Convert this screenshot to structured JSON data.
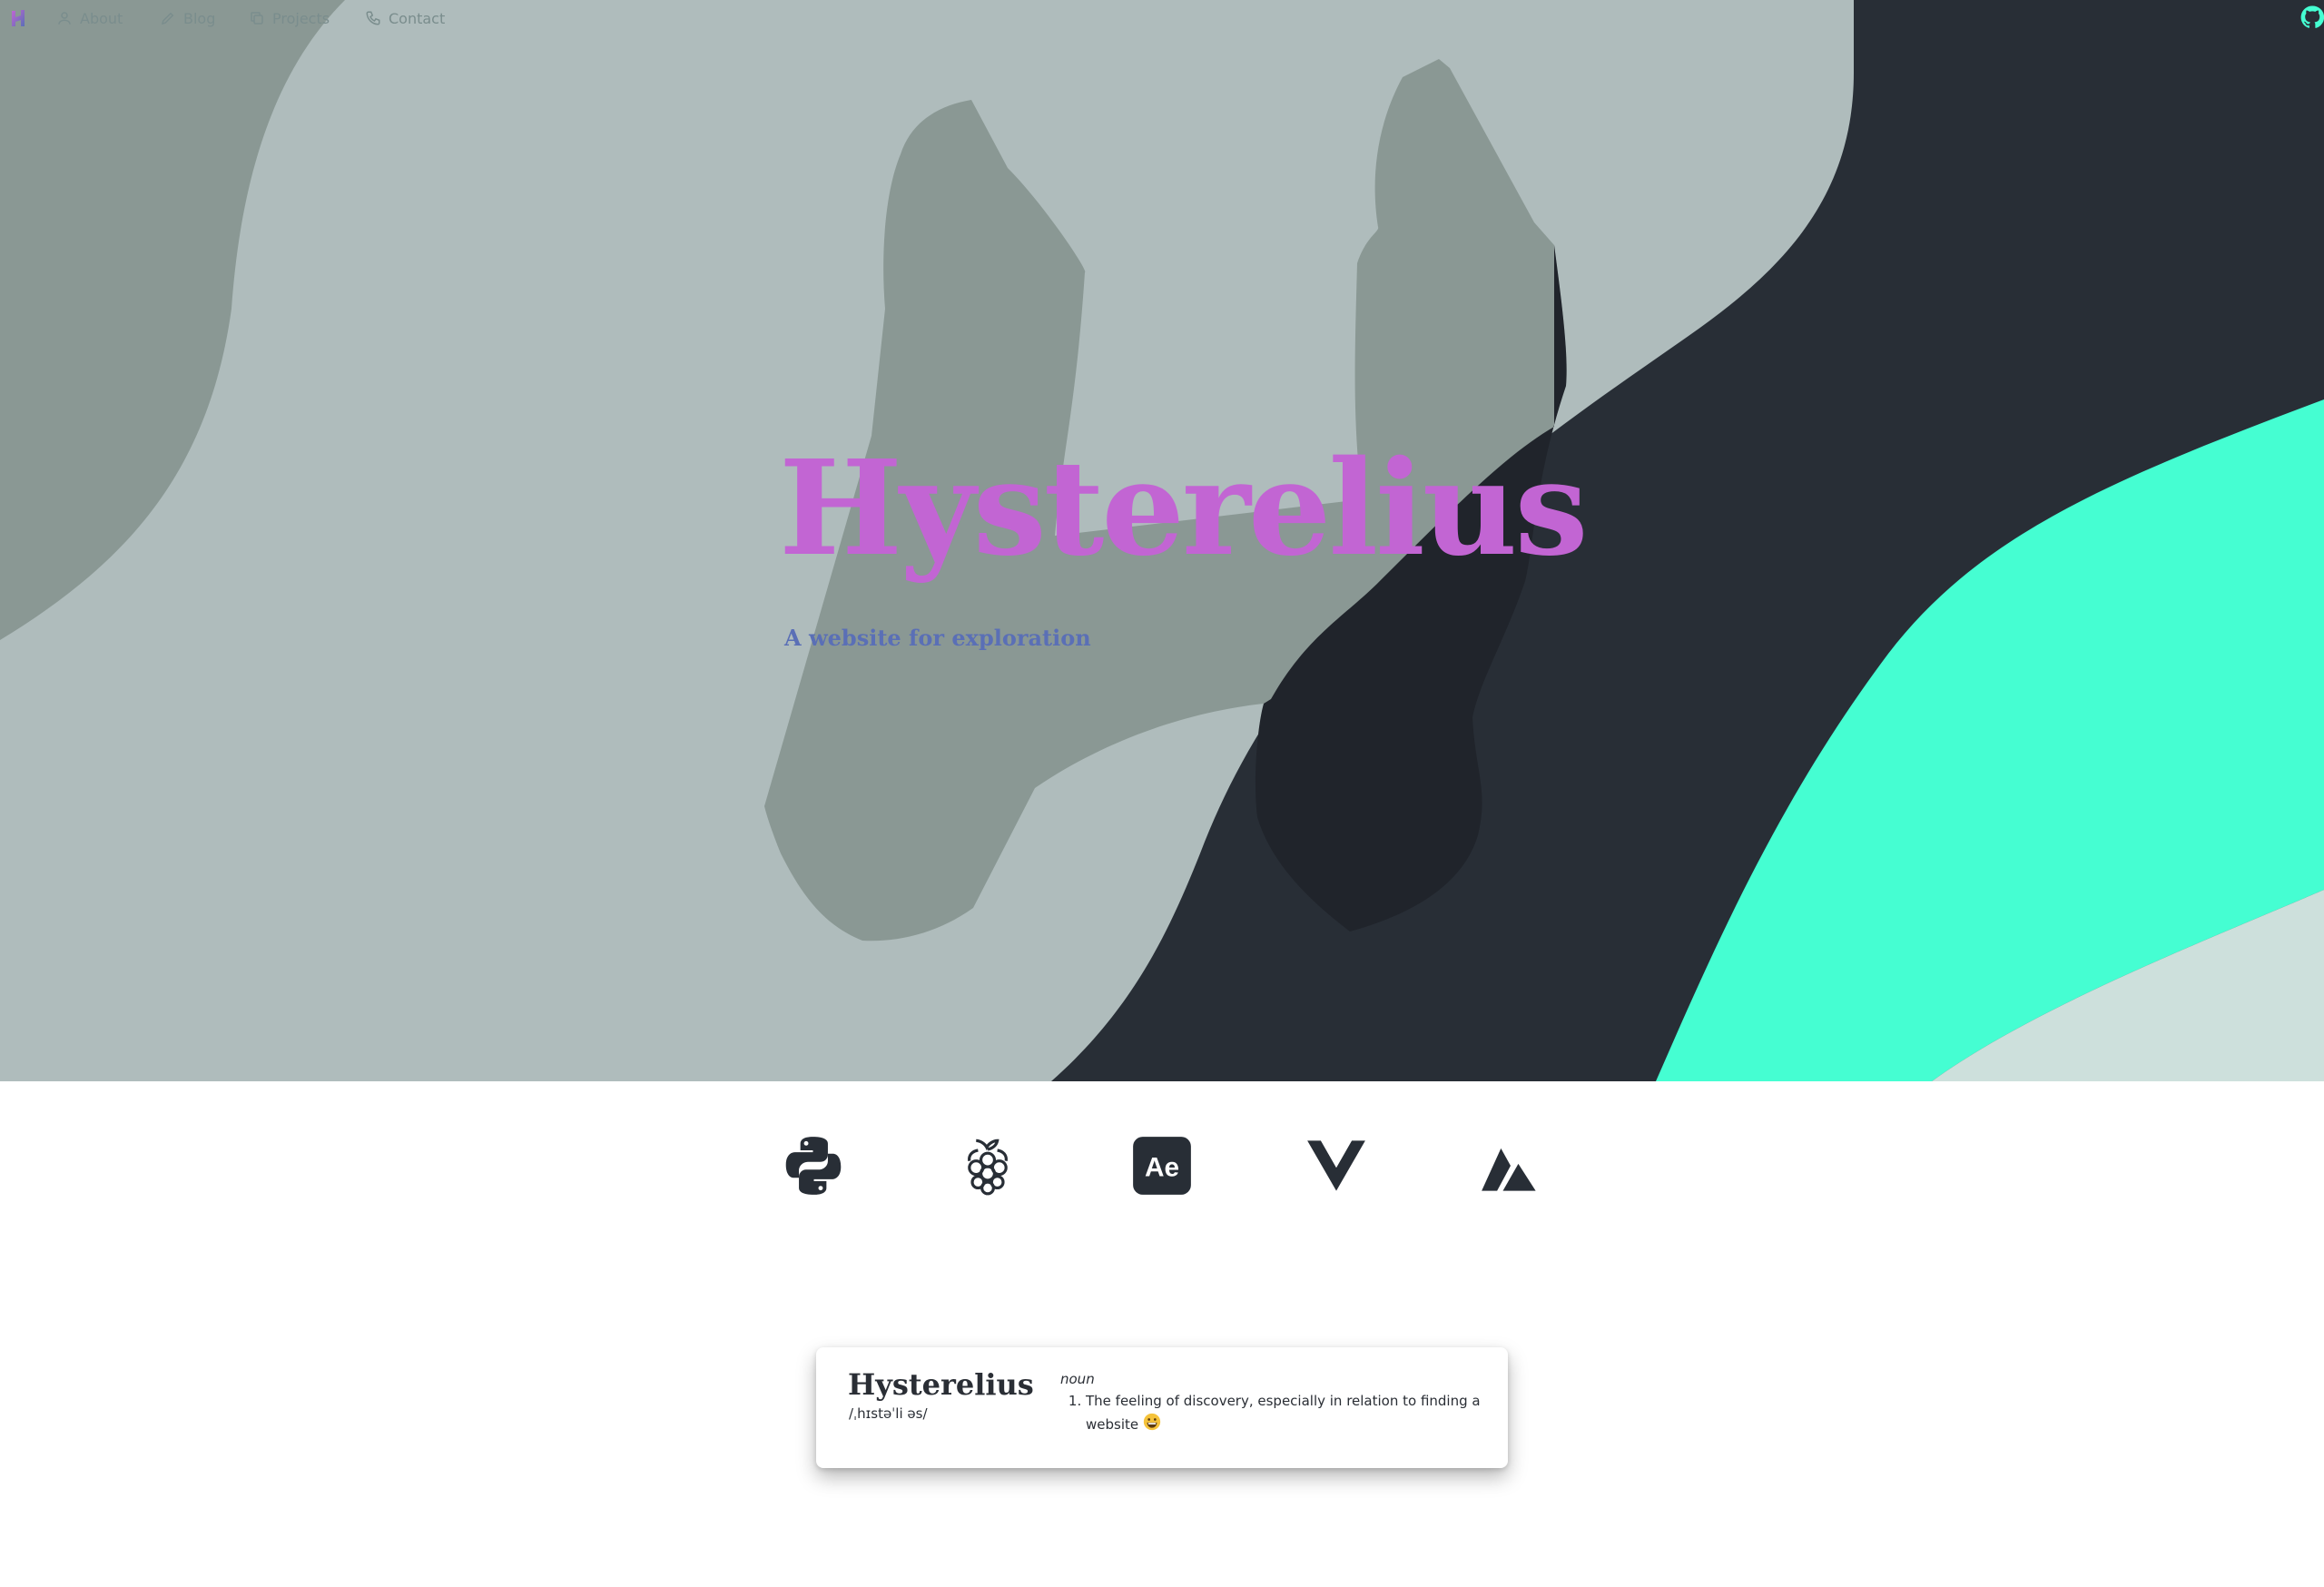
{
  "nav": {
    "items": [
      {
        "label": "About",
        "icon": "user-icon"
      },
      {
        "label": "Blog",
        "icon": "pencil-icon"
      },
      {
        "label": "Projects",
        "icon": "copy-icon"
      },
      {
        "label": "Contact",
        "icon": "phone-icon"
      }
    ],
    "github_icon": "github-icon",
    "logo_icon": "logo-icon"
  },
  "hero": {
    "title": "Hysterelius",
    "subtitle": "A website for exploration"
  },
  "tech_icons": [
    "python-icon",
    "raspberry-pi-icon",
    "after-effects-icon",
    "vue-icon",
    "nuxt-icon"
  ],
  "tech_badge_text": "Ae",
  "definition": {
    "word": "Hysterelius",
    "phonetic": "/ˌhɪstəˈli əs/",
    "part_of_speech": "noun",
    "meanings": [
      "The feeling of discovery, especially in relation to finding a website"
    ],
    "emoji": "grinning-face-icon"
  },
  "colors": {
    "hero_bg": "#afbcbc",
    "shape_gray": "#8a9894",
    "dark": "#282e36",
    "mint": "#45fed2",
    "title": "#c265d3",
    "subtitle": "#5a6fb6",
    "nav_text": "#7a8d8d"
  }
}
